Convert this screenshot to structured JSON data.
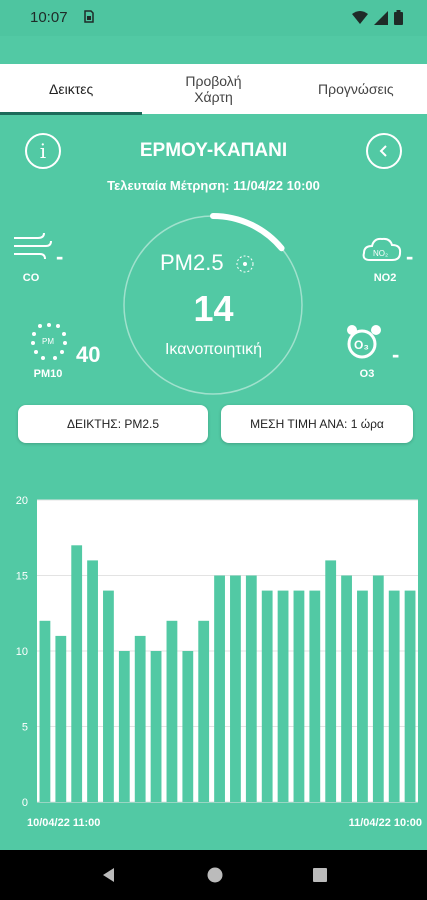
{
  "status": {
    "time": "10:07",
    "sim_icon": "sim-card-icon"
  },
  "tabs": [
    {
      "label": "Δεικτες",
      "active": true
    },
    {
      "label": "Προβολή Χάρτη",
      "active": false
    },
    {
      "label": "Προγνώσεις",
      "active": false
    }
  ],
  "station": {
    "name": "ΕΡΜΟΥ-ΚΑΠΑΝΙ",
    "last_measurement": "Τελευταία Μέτρηση: 11/04/22 10:00"
  },
  "gauge": {
    "pollutant": "PM2.5",
    "value": "14",
    "status": "Ικανοποιητική",
    "level_fraction": 0.14
  },
  "pollutants": {
    "co": {
      "label": "CO",
      "value": "-"
    },
    "no2": {
      "label": "NO2",
      "value": "-"
    },
    "pm10": {
      "label": "PM10",
      "value": "40"
    },
    "o3": {
      "label": "O3",
      "value": "-"
    }
  },
  "buttons": {
    "index": "ΔΕΙΚΤΗΣ: PM2.5",
    "average": "ΜΕΣΗ ΤΙΜΗ ΑΝΑ: 1 ώρα"
  },
  "colors": {
    "accent": "#52c9a4",
    "bar": "#52c9a4",
    "chart_bg": "#ffffff",
    "tab_indicator": "#1c6b5a"
  },
  "chart_data": {
    "type": "bar",
    "ylim": [
      0,
      20
    ],
    "yticks": [
      "0",
      "5",
      "10",
      "15",
      "20"
    ],
    "x_start_label": "10/04/22 11:00",
    "x_end_label": "11/04/22 10:00",
    "values": [
      12,
      11,
      17,
      16,
      14,
      10,
      11,
      10,
      12,
      10,
      12,
      15,
      15,
      15,
      14,
      14,
      14,
      14,
      16,
      15,
      14,
      15,
      14,
      14
    ]
  }
}
